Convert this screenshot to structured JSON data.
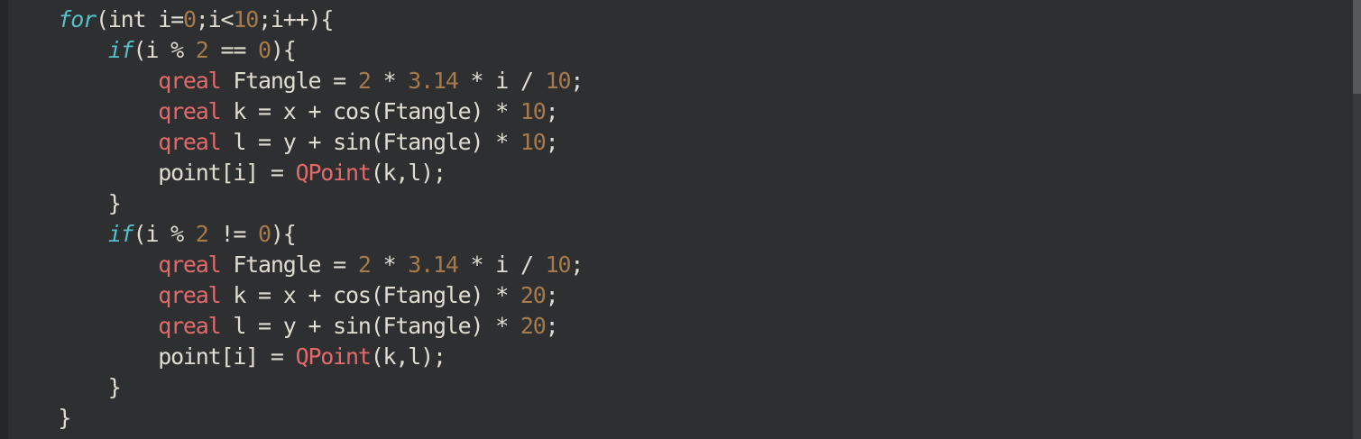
{
  "editor": {
    "colors": {
      "background": "#2e2f31",
      "plain": "#e0dcd2",
      "keyword": "#55c0cc",
      "number": "#a67a4b",
      "type": "#e36a6a"
    },
    "lines": [
      [
        {
          "t": "    ",
          "c": "p"
        },
        {
          "t": "for",
          "c": "k"
        },
        {
          "t": "(int i=",
          "c": "p"
        },
        {
          "t": "0",
          "c": "n"
        },
        {
          "t": ";i<",
          "c": "p"
        },
        {
          "t": "10",
          "c": "n"
        },
        {
          "t": ";i++){",
          "c": "p"
        }
      ],
      [
        {
          "t": "        ",
          "c": "p"
        },
        {
          "t": "if",
          "c": "k"
        },
        {
          "t": "(i % ",
          "c": "p"
        },
        {
          "t": "2",
          "c": "n"
        },
        {
          "t": " == ",
          "c": "p"
        },
        {
          "t": "0",
          "c": "n"
        },
        {
          "t": "){",
          "c": "p"
        }
      ],
      [
        {
          "t": "            ",
          "c": "p"
        },
        {
          "t": "qreal",
          "c": "q"
        },
        {
          "t": " Ftangle = ",
          "c": "p"
        },
        {
          "t": "2",
          "c": "n"
        },
        {
          "t": " * ",
          "c": "p"
        },
        {
          "t": "3.14",
          "c": "n"
        },
        {
          "t": " * i / ",
          "c": "p"
        },
        {
          "t": "10",
          "c": "n"
        },
        {
          "t": ";",
          "c": "p"
        }
      ],
      [
        {
          "t": "            ",
          "c": "p"
        },
        {
          "t": "qreal",
          "c": "q"
        },
        {
          "t": " k = x + cos(Ftangle) * ",
          "c": "p"
        },
        {
          "t": "10",
          "c": "n"
        },
        {
          "t": ";",
          "c": "p"
        }
      ],
      [
        {
          "t": "            ",
          "c": "p"
        },
        {
          "t": "qreal",
          "c": "q"
        },
        {
          "t": " l = y + sin(Ftangle) * ",
          "c": "p"
        },
        {
          "t": "10",
          "c": "n"
        },
        {
          "t": ";",
          "c": "p"
        }
      ],
      [
        {
          "t": "            point[i] = ",
          "c": "p"
        },
        {
          "t": "QPoint",
          "c": "q"
        },
        {
          "t": "(k,l);",
          "c": "p"
        }
      ],
      [
        {
          "t": "        }",
          "c": "p"
        }
      ],
      [
        {
          "t": "        ",
          "c": "p"
        },
        {
          "t": "if",
          "c": "k"
        },
        {
          "t": "(i % ",
          "c": "p"
        },
        {
          "t": "2",
          "c": "n"
        },
        {
          "t": " != ",
          "c": "p"
        },
        {
          "t": "0",
          "c": "n"
        },
        {
          "t": "){",
          "c": "p"
        }
      ],
      [
        {
          "t": "            ",
          "c": "p"
        },
        {
          "t": "qreal",
          "c": "q"
        },
        {
          "t": " Ftangle = ",
          "c": "p"
        },
        {
          "t": "2",
          "c": "n"
        },
        {
          "t": " * ",
          "c": "p"
        },
        {
          "t": "3.14",
          "c": "n"
        },
        {
          "t": " * i / ",
          "c": "p"
        },
        {
          "t": "10",
          "c": "n"
        },
        {
          "t": ";",
          "c": "p"
        }
      ],
      [
        {
          "t": "            ",
          "c": "p"
        },
        {
          "t": "qreal",
          "c": "q"
        },
        {
          "t": " k = x + cos(Ftangle) * ",
          "c": "p"
        },
        {
          "t": "20",
          "c": "n"
        },
        {
          "t": ";",
          "c": "p"
        }
      ],
      [
        {
          "t": "            ",
          "c": "p"
        },
        {
          "t": "qreal",
          "c": "q"
        },
        {
          "t": " l = y + sin(Ftangle) * ",
          "c": "p"
        },
        {
          "t": "20",
          "c": "n"
        },
        {
          "t": ";",
          "c": "p"
        }
      ],
      [
        {
          "t": "            point[i] = ",
          "c": "p"
        },
        {
          "t": "QPoint",
          "c": "q"
        },
        {
          "t": "(k,l);",
          "c": "p"
        }
      ],
      [
        {
          "t": "        }",
          "c": "p"
        }
      ],
      [
        {
          "t": "    }",
          "c": "p"
        }
      ]
    ]
  }
}
